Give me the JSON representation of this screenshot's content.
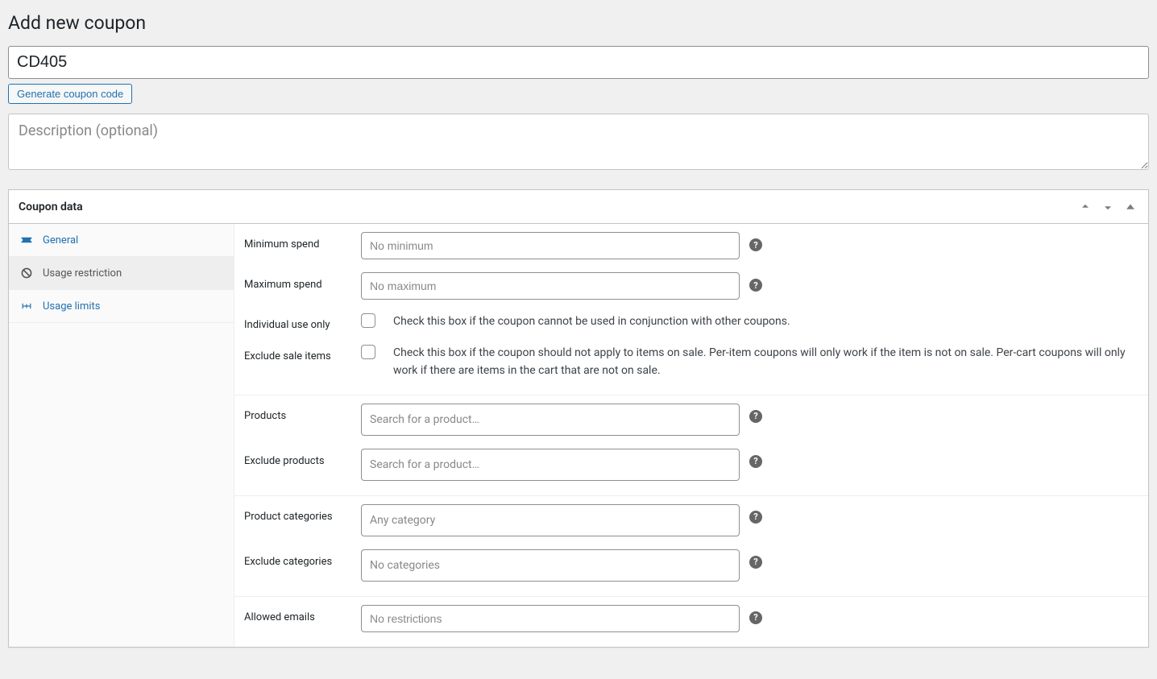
{
  "page": {
    "title": "Add new coupon"
  },
  "coupon": {
    "code": "CD405",
    "description": "",
    "description_placeholder": "Description (optional)"
  },
  "buttons": {
    "generate_code": "Generate coupon code"
  },
  "postbox": {
    "title": "Coupon data"
  },
  "tabs": {
    "general": "General",
    "usage_restriction": "Usage restriction",
    "usage_limits": "Usage limits"
  },
  "fields": {
    "minimum_spend": {
      "label": "Minimum spend",
      "placeholder": "No minimum",
      "value": ""
    },
    "maximum_spend": {
      "label": "Maximum spend",
      "placeholder": "No maximum",
      "value": ""
    },
    "individual_use": {
      "label": "Individual use only",
      "description": "Check this box if the coupon cannot be used in conjunction with other coupons."
    },
    "exclude_sale": {
      "label": "Exclude sale items",
      "description": "Check this box if the coupon should not apply to items on sale. Per-item coupons will only work if the item is not on sale. Per-cart coupons will only work if there are items in the cart that are not on sale."
    },
    "products": {
      "label": "Products",
      "placeholder": "Search for a product…"
    },
    "exclude_products": {
      "label": "Exclude products",
      "placeholder": "Search for a product…"
    },
    "product_categories": {
      "label": "Product categories",
      "placeholder": "Any category"
    },
    "exclude_categories": {
      "label": "Exclude categories",
      "placeholder": "No categories"
    },
    "allowed_emails": {
      "label": "Allowed emails",
      "placeholder": "No restrictions",
      "value": ""
    }
  }
}
